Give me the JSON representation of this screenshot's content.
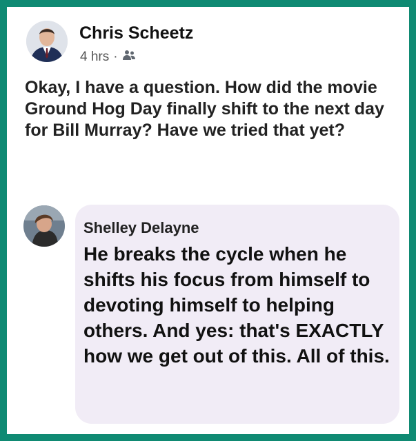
{
  "post": {
    "author": "Chris Scheetz",
    "time": "4 hrs",
    "separator": "·",
    "audience_icon": "friends-icon",
    "text": "Okay, I have a question. How did the movie Ground Hog Day finally shift to the next day for Bill Murray? Have we tried that yet?"
  },
  "comment": {
    "author": "Shelley Delayne",
    "text": "He breaks the cycle when he shifts his focus from himself to devoting himself to helping others. And yes: that's EXACTLY how we get out of this. All of this."
  },
  "colors": {
    "border": "#0f8a73",
    "bubble": "#f1ecf6",
    "background": "#ffffff"
  }
}
